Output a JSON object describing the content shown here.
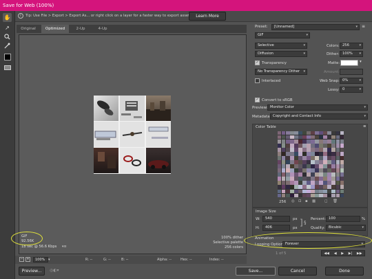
{
  "window": {
    "title": "Save for Web (100%)"
  },
  "tip": {
    "text": "Tip: Use File > Export > Export As... or right click on a layer for a faster way to export assets",
    "button": "Learn More"
  },
  "tabs": [
    "Original",
    "Optimized",
    "2-Up",
    "4-Up"
  ],
  "image_info": {
    "format": "GIF",
    "size": "92.56K",
    "download": "18 sec @ 56.6 Kbps",
    "dither": "100% dither",
    "palette": "Selective palette",
    "colors": "256 colors"
  },
  "status": {
    "zoom": "100%",
    "r": "R: --",
    "g": "G: --",
    "b": "B: --",
    "alpha": "Alpha: --",
    "hex": "Hex: --",
    "index": "Index: --"
  },
  "panel": {
    "preset_label": "Preset:",
    "preset_value": "[Unnamed]",
    "format": "GIF",
    "reduction": "Selective",
    "dither_algo": "Diffusion",
    "colors_label": "Colors:",
    "colors_value": "256",
    "dither_label": "Dither:",
    "dither_value": "100%",
    "transparency": "Transparency",
    "matte_label": "Matte:",
    "transparency_dither": "No Transparency Dither",
    "amount_label": "Amount:",
    "interlaced": "Interlaced",
    "websnap_label": "Web Snap:",
    "websnap_value": "0%",
    "lossy_label": "Lossy:",
    "lossy_value": "0",
    "convert_srgb": "Convert to sRGB",
    "preview_label": "Preview:",
    "preview_value": "Monitor Color",
    "metadata_label": "Metadata:",
    "metadata_value": "Copyright and Contact Info",
    "color_table": "Color Table",
    "color_count": "256",
    "image_size": "Image Size",
    "w_label": "W:",
    "w_value": "540",
    "h_label": "H:",
    "h_value": "406",
    "px": "px",
    "percent_label": "Percent:",
    "percent_value": "100",
    "percent_unit": "%",
    "quality_label": "Quality:",
    "quality_value": "Bicubic",
    "animation": "Animation",
    "looping_label": "Looping Options:",
    "looping_value": "Forever",
    "frame": "1 of 5"
  },
  "buttons": {
    "preview": "Preview...",
    "save": "Save...",
    "cancel": "Cancel",
    "done": "Done"
  },
  "colors": {
    "title_bar": "#d4147c",
    "annotation": "#e3e43a"
  }
}
